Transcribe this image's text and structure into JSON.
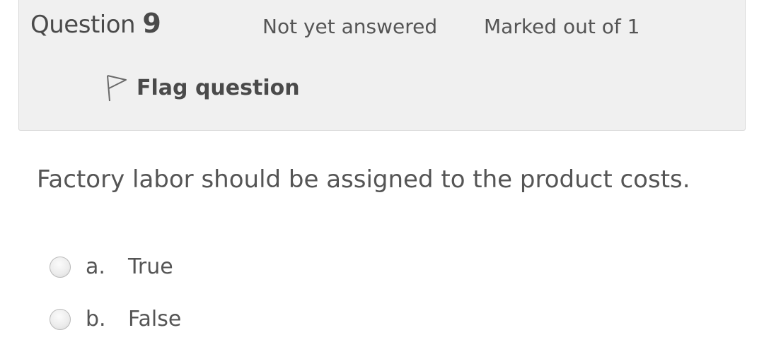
{
  "info": {
    "question_word": "Question",
    "question_number": "9",
    "state": "Not yet answered",
    "grade": "Marked out of 1",
    "flag_label": "Flag question",
    "flag_icon": "flag-outline-icon"
  },
  "question": {
    "text": "Factory labor should be assigned to the product costs."
  },
  "answers": [
    {
      "letter": "a.",
      "text": "True",
      "selected": false
    },
    {
      "letter": "b.",
      "text": "False",
      "selected": false
    }
  ],
  "colors": {
    "panel_bg": "#f0f0f0",
    "panel_border": "#d8d8d8",
    "text": "#555555"
  }
}
